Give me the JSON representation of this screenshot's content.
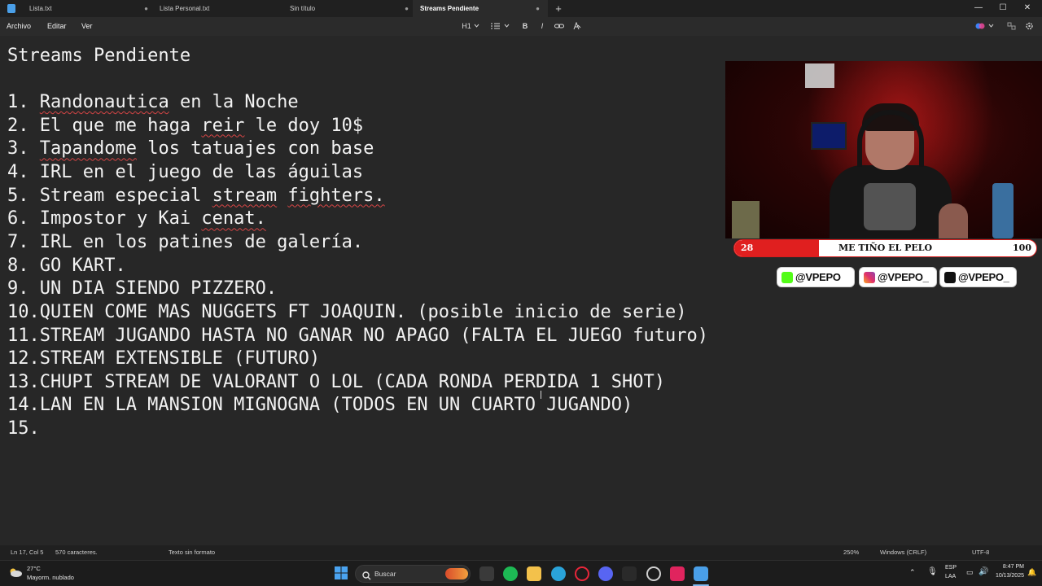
{
  "tabs": [
    {
      "label": "Lista.txt",
      "close": "●"
    },
    {
      "label": "Lista Personal.txt",
      "close": ""
    },
    {
      "label": "Sin título",
      "close": "●"
    },
    {
      "label": "Streams Pendiente",
      "close": "●"
    }
  ],
  "new_tab": "+",
  "window": {
    "minimize": "—",
    "maximize": "☐",
    "close": "✕"
  },
  "menu": [
    "Archivo",
    "Editar",
    "Ver"
  ],
  "toolbar": {
    "heading": "H1",
    "bold": "B",
    "italic": "I"
  },
  "document": {
    "title": "Streams Pendiente",
    "lines": [
      "1. Randonautica en la Noche",
      "2. El que me haga reir le doy 10$",
      "3. Tapandome los tatuajes con base",
      "4. IRL en el juego de las águilas",
      "5. Stream especial stream fighters.",
      "6. Impostor y Kai cenat.",
      "7. IRL en los patines de galería.",
      "8. GO KART.",
      "9. UN DIA SIENDO PIZZERO.",
      "10.QUIEN COME MAS NUGGETS FT JOAQUIN. (posible inicio de serie)",
      "11.STREAM JUGANDO HASTA NO GANAR NO APAGO (FALTA EL JUEGO futuro)",
      "12.STREAM EXTENSIBLE (FUTURO)",
      "13.CHUPI STREAM DE VALORANT O LOL (CADA RONDA PERDIDA 1 SHOT)",
      "14.LAN EN LA MANSION MIGNOGNA (TODOS EN UN CUARTO JUGANDO)",
      "15."
    ]
  },
  "overlay": {
    "goal": {
      "current": "28",
      "title": "ME TIÑO EL PELO",
      "max": "100",
      "progress": 0.28
    },
    "socials": [
      {
        "network": "kick",
        "handle": "@VPEPO",
        "color": "#53fc18"
      },
      {
        "network": "instagram",
        "handle": "@VPEPO_",
        "color": "#e1306c"
      },
      {
        "network": "tiktok",
        "handle": "@VPEPO_",
        "color": "#111111"
      }
    ]
  },
  "status": {
    "position": "Ln 17, Col 5",
    "chars": "570 caracteres.",
    "format": "Texto sin formato",
    "zoom": "250%",
    "line_ending": "Windows (CRLF)",
    "encoding": "UTF-8"
  },
  "taskbar": {
    "weather_temp": "27°C",
    "weather_desc": "Mayorm. nublado",
    "search_placeholder": "Buscar",
    "lang_top": "ESP",
    "lang_bottom": "LAA",
    "time": "8:47 PM",
    "date": "10/13/2025"
  },
  "colors": {
    "accent": "#e01f1f",
    "editor_bg": "#272727",
    "spell_error": "#d64545"
  }
}
